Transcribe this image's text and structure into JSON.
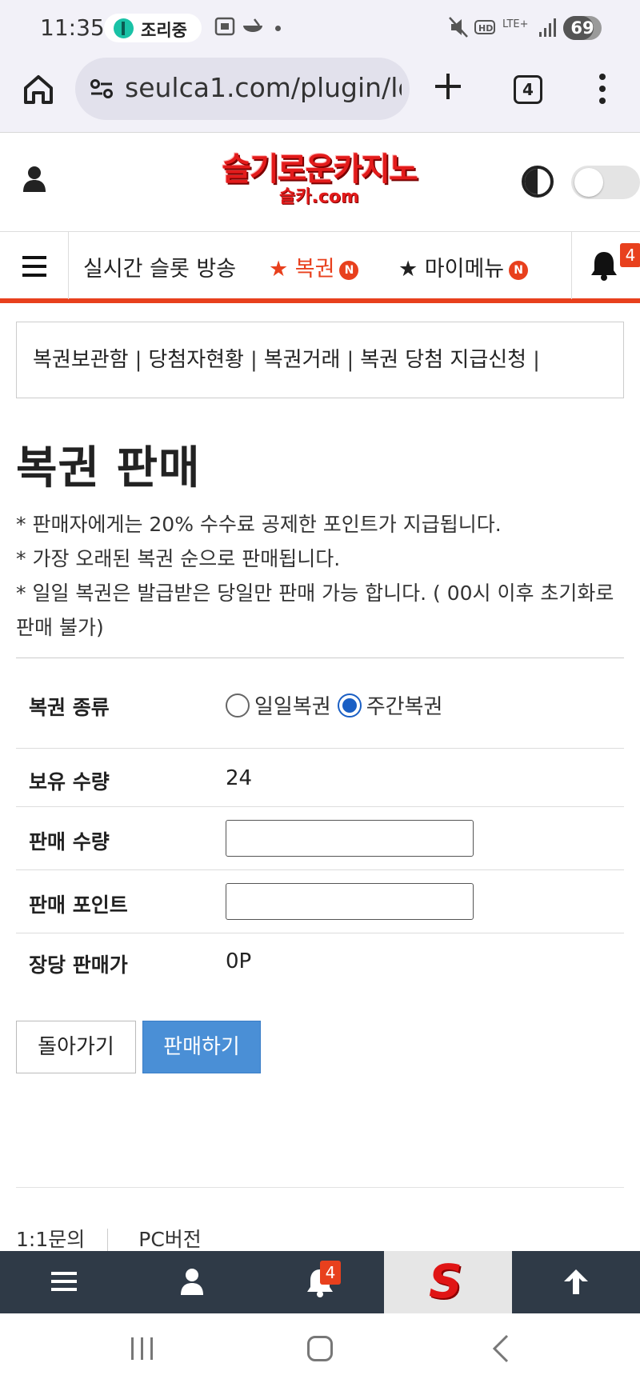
{
  "status_bar": {
    "time": "11:35",
    "pill_text": "조리중",
    "network": "LTE+",
    "battery": "69"
  },
  "browser": {
    "url": "seulca1.com/plugin/lo",
    "tab_count": "4"
  },
  "site": {
    "logo_main": "슬기로운카지노",
    "logo_sub": "슬카.com",
    "brand_color": "#e8401d"
  },
  "nav": {
    "items": [
      {
        "label": "실시간 슬롯 방송",
        "active": false,
        "badge": ""
      },
      {
        "label": "★ 복권",
        "active": true,
        "badge": "N"
      },
      {
        "label": "★ 마이메뉴",
        "active": false,
        "badge": "N"
      }
    ],
    "bell_count": "4"
  },
  "submenu": {
    "items": [
      "복권보관함",
      "당첨자현황",
      "복권거래",
      "복권 당첨 지급신청"
    ],
    "separator": "|"
  },
  "page": {
    "title": "복권 판매",
    "notes": [
      "* 판매자에게는 20% 수수료 공제한 포인트가 지급됩니다.",
      "* 가장 오래된 복권 순으로 판매됩니다.",
      "* 일일 복권은 발급받은 당일만 판매 가능 합니다. ( 00시 이후 초기화로 판매 불가)"
    ]
  },
  "form": {
    "type_label": "복권 종류",
    "type_options": [
      {
        "label": "일일복권",
        "checked": false
      },
      {
        "label": "주간복권",
        "checked": true
      }
    ],
    "owned_label": "보유 수량",
    "owned_value": "24",
    "qty_label": "판매 수량",
    "qty_value": "",
    "points_label": "판매 포인트",
    "points_value": "",
    "unit_label": "장당 판매가",
    "unit_value": "0P"
  },
  "buttons": {
    "back": "돌아가기",
    "sell": "판매하기"
  },
  "footer": {
    "links": [
      "1:1문의",
      "PC버전"
    ]
  },
  "bottom_bar": {
    "bell_count": "4",
    "logo_letter": "S"
  }
}
